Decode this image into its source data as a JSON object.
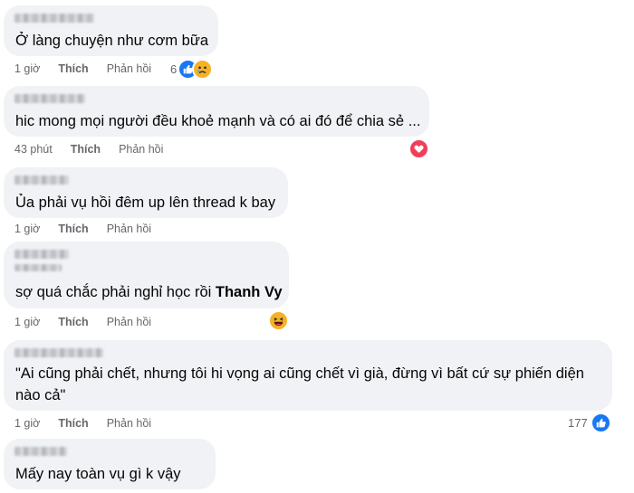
{
  "comments": [
    {
      "text": "Ở làng chuyện như cơm bữa",
      "time": "1 giờ",
      "like": "Thích",
      "reply": "Phản hồi",
      "reaction_count": "6",
      "reactions": [
        "like-icon",
        "sad-icon"
      ]
    },
    {
      "text": "hic mong mọi người đều khoẻ mạnh và có ai đó để chia sẻ ...",
      "time": "43 phút",
      "like": "Thích",
      "reply": "Phản hồi",
      "reaction_count": "",
      "reactions": [
        "love-icon"
      ]
    },
    {
      "text": "Ủa phải vụ hồi đêm up lên thread k bay",
      "time": "1 giờ",
      "like": "Thích",
      "reply": "Phản hồi",
      "reaction_count": "",
      "reactions": []
    },
    {
      "text": "sợ quá chắc phải nghỉ học rồi",
      "mention": "Thanh Vy",
      "time": "1 giờ",
      "like": "Thích",
      "reply": "Phản hồi",
      "reaction_count": "",
      "reactions": [
        "haha-icon"
      ]
    },
    {
      "text": "\"Ai cũng phải chết, nhưng tôi hi vọng ai cũng chết vì già, đừng vì bất cứ sự phiến diện nào cả\"",
      "time": "1 giờ",
      "like": "Thích",
      "reply": "Phản hồi",
      "reaction_count": "177",
      "reactions": [
        "like-icon"
      ]
    },
    {
      "text": "Mấy nay toàn vụ gì k vậy",
      "time": "",
      "like": "",
      "reply": "",
      "reaction_count": "",
      "reactions": []
    }
  ],
  "colors": {
    "bubble": "#f0f2f5",
    "meta": "#65676b",
    "like": "#1877f2",
    "love": "#f33e58",
    "haha": "#f7b125"
  }
}
